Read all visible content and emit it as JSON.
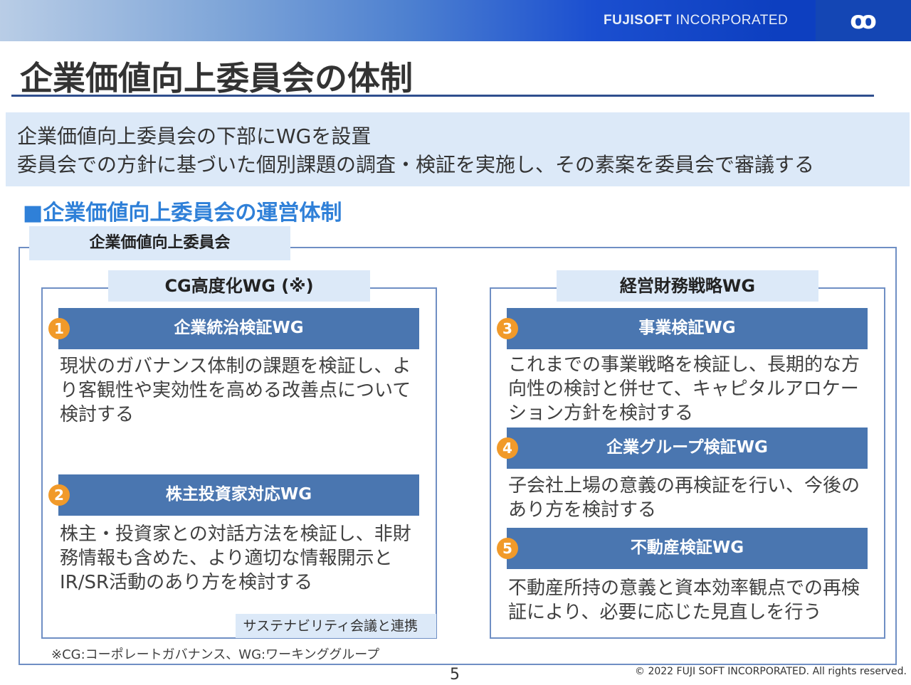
{
  "header": {
    "brand_bold": "FUJISOFT",
    "brand_rest": " INCORPORATED",
    "logo": "logo-icon"
  },
  "title": "企業価値向上委員会の体制",
  "banner": {
    "line1": "企業価値向上委員会の下部にWGを設置",
    "line2": "委員会での方針に基づいた個別課題の調査・検証を実施し、その素案を委員会で審議する"
  },
  "section": "■企業価値向上委員会の運営体制",
  "committee": "企業価値向上委員会",
  "left_group": {
    "label": "CG高度化WG (※)",
    "note": "サステナビリティ会議と連携",
    "items": [
      {
        "num": "1",
        "title": "企業統治検証WG",
        "desc": "現状のガバナンス体制の課題を検証し、より客観性や実効性を高める改善点について検討する"
      },
      {
        "num": "2",
        "title": "株主投資家対応WG",
        "desc": "株主・投資家との対話方法を検証し、非財務情報も含めた、より適切な情報開示とIR/SR活動のあり方を検討する"
      }
    ]
  },
  "right_group": {
    "label": "経営財務戦略WG",
    "items": [
      {
        "num": "3",
        "title": "事業検証WG",
        "desc": "これまでの事業戦略を検証し、長期的な方向性の検討と併せて、キャピタルアロケーション方針を検討する"
      },
      {
        "num": "4",
        "title": "企業グループ検証WG",
        "desc": "子会社上場の意義の再検証を行い、今後のあり方を検討する"
      },
      {
        "num": "5",
        "title": "不動産検証WG",
        "desc": "不動産所持の意義と資本効率観点での再検証により、必要に応じた見直しを行う"
      }
    ]
  },
  "footnote": "※CG:コーポレートガバナンス、WG:ワーキンググループ",
  "page": "5",
  "copyright": "© 2022 FUJI SOFT INCORPORATED. All rights reserved."
}
